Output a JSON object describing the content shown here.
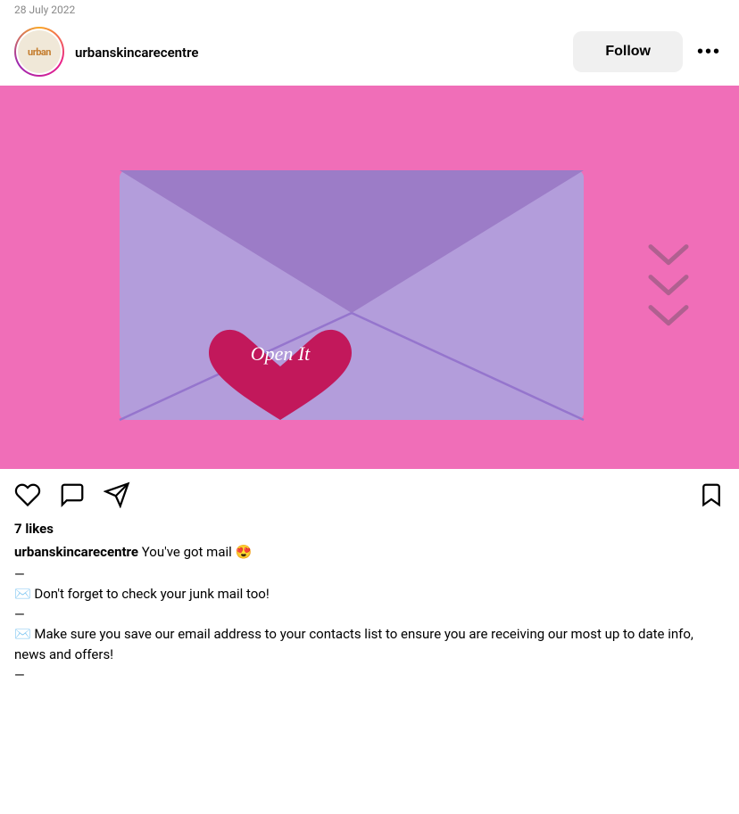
{
  "date": "28 July 2022",
  "header": {
    "username": "urbanskincarecentre",
    "avatar_label": "urban",
    "follow_label": "Follow",
    "more_label": "•••"
  },
  "post": {
    "image_alt": "Purple envelope with pink heart and Open It text on pink background",
    "envelope_text": "Open It",
    "likes": "7 likes",
    "caption_handle": "urbanskincarecentre",
    "caption_text": "You've got mail 😍",
    "dash1": "—",
    "line1": "✉️ Don't forget to check your junk mail too!",
    "dash2": "—",
    "line2": "✉️ Make sure you save our email address to your contacts list to ensure you are receiving our most up to date info, news and offers!",
    "dash3": "—"
  },
  "actions": {
    "like_icon": "heart",
    "comment_icon": "comment",
    "share_icon": "send",
    "bookmark_icon": "bookmark"
  }
}
